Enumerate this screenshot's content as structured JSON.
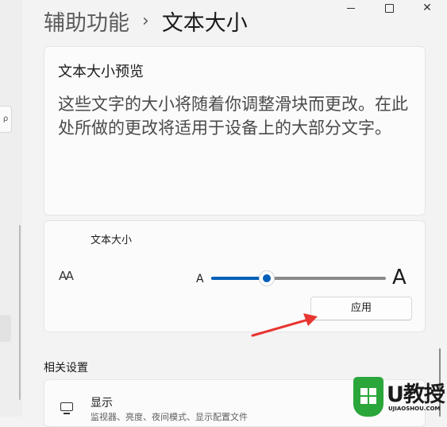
{
  "breadcrumb": {
    "parent": "辅助功能",
    "separator": "›",
    "current": "文本大小"
  },
  "window_controls": {
    "close_glyph": "✕"
  },
  "left_panel": {
    "mini_button_glyph": "ρ"
  },
  "preview": {
    "title": "文本大小预览",
    "body": "这些文字的大小将随着你调整滑块而更改。在此处所做的更改将适用于设备上的大部分文字。"
  },
  "text_size": {
    "label": "文本大小",
    "icon_glyph": "AA",
    "min_glyph": "A",
    "max_glyph": "A",
    "slider_percent": 32,
    "apply_label": "应用"
  },
  "related": {
    "title": "相关设置",
    "display_title": "显示",
    "display_desc": "监视器、亮度、夜间模式、显示配置文件"
  },
  "watermark": {
    "name": "U教授",
    "url": "UJIAOSHOU.COM"
  },
  "colors": {
    "accent": "#005fb8",
    "arrow": "#e8352f",
    "watermark_green": "#2aa63a"
  }
}
